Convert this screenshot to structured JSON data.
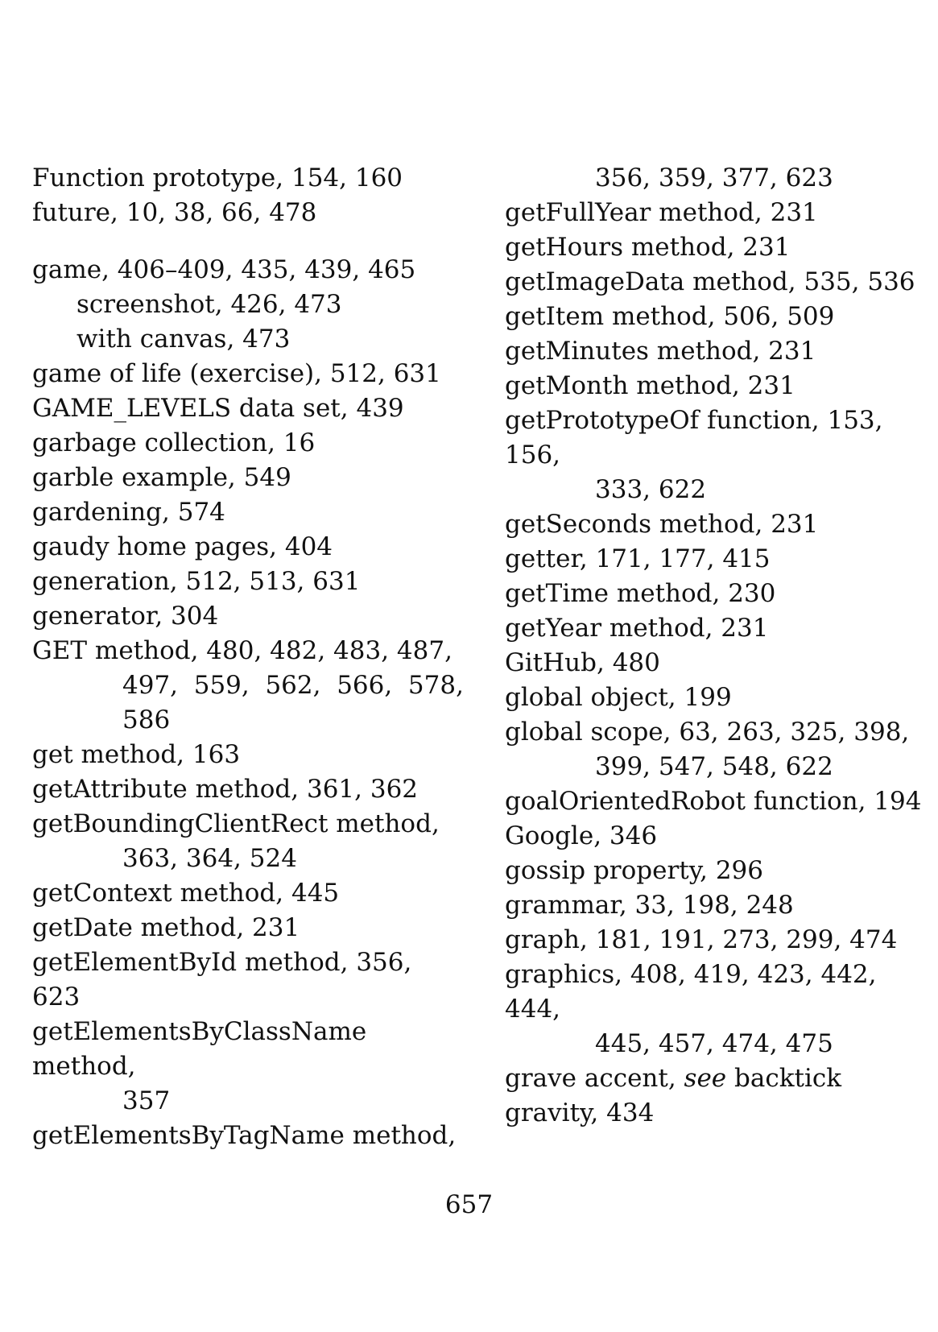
{
  "index": {
    "left_column": [
      {
        "kind": "entry",
        "text": "Function prototype, 154, 160"
      },
      {
        "kind": "entry",
        "text": "future, 10, 38, 66, 478"
      },
      {
        "kind": "gap"
      },
      {
        "kind": "entry",
        "text": "game, 406–409, 435, 439, 465"
      },
      {
        "kind": "sub",
        "text": "screenshot, 426, 473"
      },
      {
        "kind": "sub",
        "text": "with canvas, 473"
      },
      {
        "kind": "entry",
        "text": "game of life (exercise), 512, 631"
      },
      {
        "kind": "entry",
        "text": "GAME_LEVELS data set, 439"
      },
      {
        "kind": "entry",
        "text": "garbage collection, 16"
      },
      {
        "kind": "entry",
        "text": "garble example, 549"
      },
      {
        "kind": "entry",
        "text": "gardening, 574"
      },
      {
        "kind": "entry",
        "text": "gaudy home pages, 404"
      },
      {
        "kind": "entry",
        "text": "generation, 512, 513, 631"
      },
      {
        "kind": "entry",
        "text": "generator, 304"
      },
      {
        "kind": "entry",
        "text": "GET method, 480, 482, 483, 487,"
      },
      {
        "kind": "cont",
        "text": "497,  559,  562,  566,  578,"
      },
      {
        "kind": "cont",
        "text": "586"
      },
      {
        "kind": "entry",
        "text": "get method, 163"
      },
      {
        "kind": "entry",
        "text": "getAttribute method, 361, 362"
      },
      {
        "kind": "entry",
        "text": "getBoundingClientRect method,"
      },
      {
        "kind": "cont",
        "text": "363, 364, 524"
      },
      {
        "kind": "entry",
        "text": "getContext method, 445"
      },
      {
        "kind": "entry",
        "text": "getDate method, 231"
      },
      {
        "kind": "entry",
        "text": "getElementById method, 356, 623"
      },
      {
        "kind": "entry",
        "text": "getElementsByClassName method,"
      },
      {
        "kind": "cont",
        "text": "357"
      },
      {
        "kind": "entry",
        "text": "getElementsByTagName method,"
      }
    ],
    "right_column": [
      {
        "kind": "cont",
        "text": "356, 359, 377, 623"
      },
      {
        "kind": "entry",
        "text": "getFullYear method, 231"
      },
      {
        "kind": "entry",
        "text": "getHours method, 231"
      },
      {
        "kind": "entry",
        "text": "getImageData method, 535, 536"
      },
      {
        "kind": "entry",
        "text": "getItem method, 506, 509"
      },
      {
        "kind": "entry",
        "text": "getMinutes method, 231"
      },
      {
        "kind": "entry",
        "text": "getMonth method, 231"
      },
      {
        "kind": "entry",
        "text": "getPrototypeOf function, 153, 156,"
      },
      {
        "kind": "cont",
        "text": "333, 622"
      },
      {
        "kind": "entry",
        "text": "getSeconds method, 231"
      },
      {
        "kind": "entry",
        "text": "getter, 171, 177, 415"
      },
      {
        "kind": "entry",
        "text": "getTime method, 230"
      },
      {
        "kind": "entry",
        "text": "getYear method, 231"
      },
      {
        "kind": "entry",
        "text": "GitHub, 480"
      },
      {
        "kind": "entry",
        "text": "global object, 199"
      },
      {
        "kind": "entry",
        "text": "global scope, 63, 263, 325, 398,"
      },
      {
        "kind": "cont",
        "text": "399, 547, 548, 622"
      },
      {
        "kind": "entry",
        "text": "goalOrientedRobot function, 194"
      },
      {
        "kind": "entry",
        "text": "Google, 346"
      },
      {
        "kind": "entry",
        "text": "gossip property, 296"
      },
      {
        "kind": "entry",
        "text": "grammar, 33, 198, 248"
      },
      {
        "kind": "entry",
        "text": "graph, 181, 191, 273, 299, 474"
      },
      {
        "kind": "entry",
        "text": "graphics, 408, 419, 423, 442, 444,"
      },
      {
        "kind": "cont",
        "text": "445, 457, 474, 475"
      },
      {
        "kind": "entry",
        "text": "grave accent, ",
        "italic": "see",
        "after": " backtick"
      },
      {
        "kind": "entry",
        "text": "gravity, 434"
      }
    ]
  },
  "footer": {
    "page_number": "657"
  }
}
